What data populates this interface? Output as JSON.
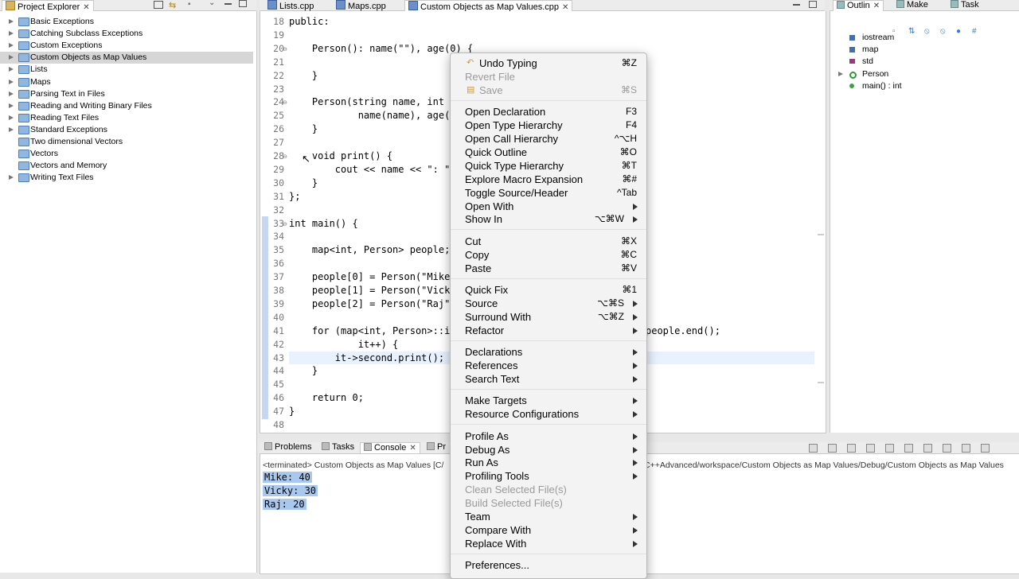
{
  "explorer": {
    "tab_label": "Project Explorer",
    "items": [
      {
        "label": "Basic Exceptions",
        "expandable": true
      },
      {
        "label": "Catching Subclass Exceptions",
        "expandable": true
      },
      {
        "label": "Custom Exceptions",
        "expandable": true
      },
      {
        "label": "Custom Objects as Map Values",
        "expandable": true,
        "selected": true
      },
      {
        "label": "Lists",
        "expandable": true
      },
      {
        "label": "Maps",
        "expandable": true
      },
      {
        "label": "Parsing Text in Files",
        "expandable": true
      },
      {
        "label": "Reading and Writing Binary Files",
        "expandable": true
      },
      {
        "label": "Reading Text Files",
        "expandable": true
      },
      {
        "label": "Standard Exceptions",
        "expandable": true
      },
      {
        "label": "Two dimensional Vectors",
        "expandable": false
      },
      {
        "label": "Vectors",
        "expandable": false
      },
      {
        "label": "Vectors and Memory",
        "expandable": false
      },
      {
        "label": "Writing Text Files",
        "expandable": true
      }
    ]
  },
  "editor": {
    "tabs": [
      {
        "label": "Lists.cpp"
      },
      {
        "label": "Maps.cpp"
      },
      {
        "label": "Custom Objects as Map Values.cpp",
        "active": true
      }
    ],
    "lines": [
      {
        "num": "18",
        "text": "public:"
      },
      {
        "num": "19",
        "text": ""
      },
      {
        "num": "20",
        "text": "    Person(): name(\"\"), age(0) {"
      },
      {
        "num": "21",
        "text": ""
      },
      {
        "num": "22",
        "text": "    }"
      },
      {
        "num": "23",
        "text": ""
      },
      {
        "num": "24",
        "text": "    Person(string name, int a"
      },
      {
        "num": "25",
        "text": "            name(name), age(a"
      },
      {
        "num": "26",
        "text": "    }"
      },
      {
        "num": "27",
        "text": ""
      },
      {
        "num": "28",
        "text": "    void print() {"
      },
      {
        "num": "29",
        "text": "        cout << name << \": \""
      },
      {
        "num": "30",
        "text": "    }"
      },
      {
        "num": "31",
        "text": "};"
      },
      {
        "num": "32",
        "text": ""
      },
      {
        "num": "33",
        "text": "int main() {"
      },
      {
        "num": "34",
        "text": ""
      },
      {
        "num": "35",
        "text": "    map<int, Person> people;"
      },
      {
        "num": "36",
        "text": ""
      },
      {
        "num": "37",
        "text": "    people[0] = Person(\"Mike\""
      },
      {
        "num": "38",
        "text": "    people[1] = Person(\"Vicky"
      },
      {
        "num": "39",
        "text": "    people[2] = Person(\"Raj\""
      },
      {
        "num": "40",
        "text": ""
      },
      {
        "num": "41",
        "text": "    for (map<int, Person>::it"
      },
      {
        "num": "42",
        "text": "            it++) {"
      },
      {
        "num": "43",
        "text": "        it->second.print();"
      },
      {
        "num": "44",
        "text": "    }"
      },
      {
        "num": "45",
        "text": ""
      },
      {
        "num": "46",
        "text": "    return 0;"
      },
      {
        "num": "47",
        "text": "}"
      },
      {
        "num": "48",
        "text": ""
      }
    ],
    "line41_tail": "people.end();"
  },
  "context_menu": {
    "groups": [
      [
        {
          "label": "Undo Typing",
          "shortcut": "⌘Z",
          "icon": "undo-icon"
        },
        {
          "label": "Revert File",
          "disabled": true
        },
        {
          "label": "Save",
          "shortcut": "⌘S",
          "disabled": true,
          "icon": "save-icon"
        }
      ],
      [
        {
          "label": "Open Declaration",
          "shortcut": "F3"
        },
        {
          "label": "Open Type Hierarchy",
          "shortcut": "F4"
        },
        {
          "label": "Open Call Hierarchy",
          "shortcut": "^⌥H"
        },
        {
          "label": "Quick Outline",
          "shortcut": "⌘O"
        },
        {
          "label": "Quick Type Hierarchy",
          "shortcut": "⌘T"
        },
        {
          "label": "Explore Macro Expansion",
          "shortcut": "⌘#"
        },
        {
          "label": "Toggle Source/Header",
          "shortcut": "^Tab"
        },
        {
          "label": "Open With",
          "submenu": true
        },
        {
          "label": "Show In",
          "shortcut": "⌥⌘W",
          "submenu": true
        }
      ],
      [
        {
          "label": "Cut",
          "shortcut": "⌘X"
        },
        {
          "label": "Copy",
          "shortcut": "⌘C"
        },
        {
          "label": "Paste",
          "shortcut": "⌘V"
        }
      ],
      [
        {
          "label": "Quick Fix",
          "shortcut": "⌘1"
        },
        {
          "label": "Source",
          "shortcut": "⌥⌘S",
          "submenu": true
        },
        {
          "label": "Surround With",
          "shortcut": "⌥⌘Z",
          "submenu": true
        },
        {
          "label": "Refactor",
          "submenu": true
        }
      ],
      [
        {
          "label": "Declarations",
          "submenu": true
        },
        {
          "label": "References",
          "submenu": true
        },
        {
          "label": "Search Text",
          "submenu": true
        }
      ],
      [
        {
          "label": "Make Targets",
          "submenu": true
        },
        {
          "label": "Resource Configurations",
          "submenu": true
        }
      ],
      [
        {
          "label": "Profile As",
          "submenu": true
        },
        {
          "label": "Debug As",
          "submenu": true
        },
        {
          "label": "Run As",
          "submenu": true
        },
        {
          "label": "Profiling Tools",
          "submenu": true
        },
        {
          "label": "Clean Selected File(s)",
          "disabled": true
        },
        {
          "label": "Build Selected File(s)",
          "disabled": true
        },
        {
          "label": "Team",
          "submenu": true
        },
        {
          "label": "Compare With",
          "submenu": true
        },
        {
          "label": "Replace With",
          "submenu": true
        }
      ],
      [
        {
          "label": "Preferences..."
        }
      ]
    ]
  },
  "outline": {
    "tabs": [
      {
        "label": "Outlin",
        "active": true
      },
      {
        "label": "Make"
      },
      {
        "label": "Task"
      }
    ],
    "items": [
      {
        "label": "iostream",
        "icon": "include-icon"
      },
      {
        "label": "map",
        "icon": "include-icon"
      },
      {
        "label": "std",
        "icon": "namespace-icon"
      },
      {
        "label": "Person",
        "icon": "class-icon",
        "expandable": true
      },
      {
        "label": "main() : int",
        "icon": "function-icon"
      }
    ]
  },
  "console": {
    "tabs": [
      {
        "label": "Problems"
      },
      {
        "label": "Tasks"
      },
      {
        "label": "Console",
        "active": true
      },
      {
        "label": "Pr"
      }
    ],
    "status_left": "<terminated> Custom Objects as Map Values [C/",
    "status_right": "C++Advanced/workspace/Custom Objects as Map Values/Debug/Custom Objects as Map Values",
    "output": [
      "Mike: 40",
      "Vicky: 30",
      "Raj: 20"
    ]
  }
}
